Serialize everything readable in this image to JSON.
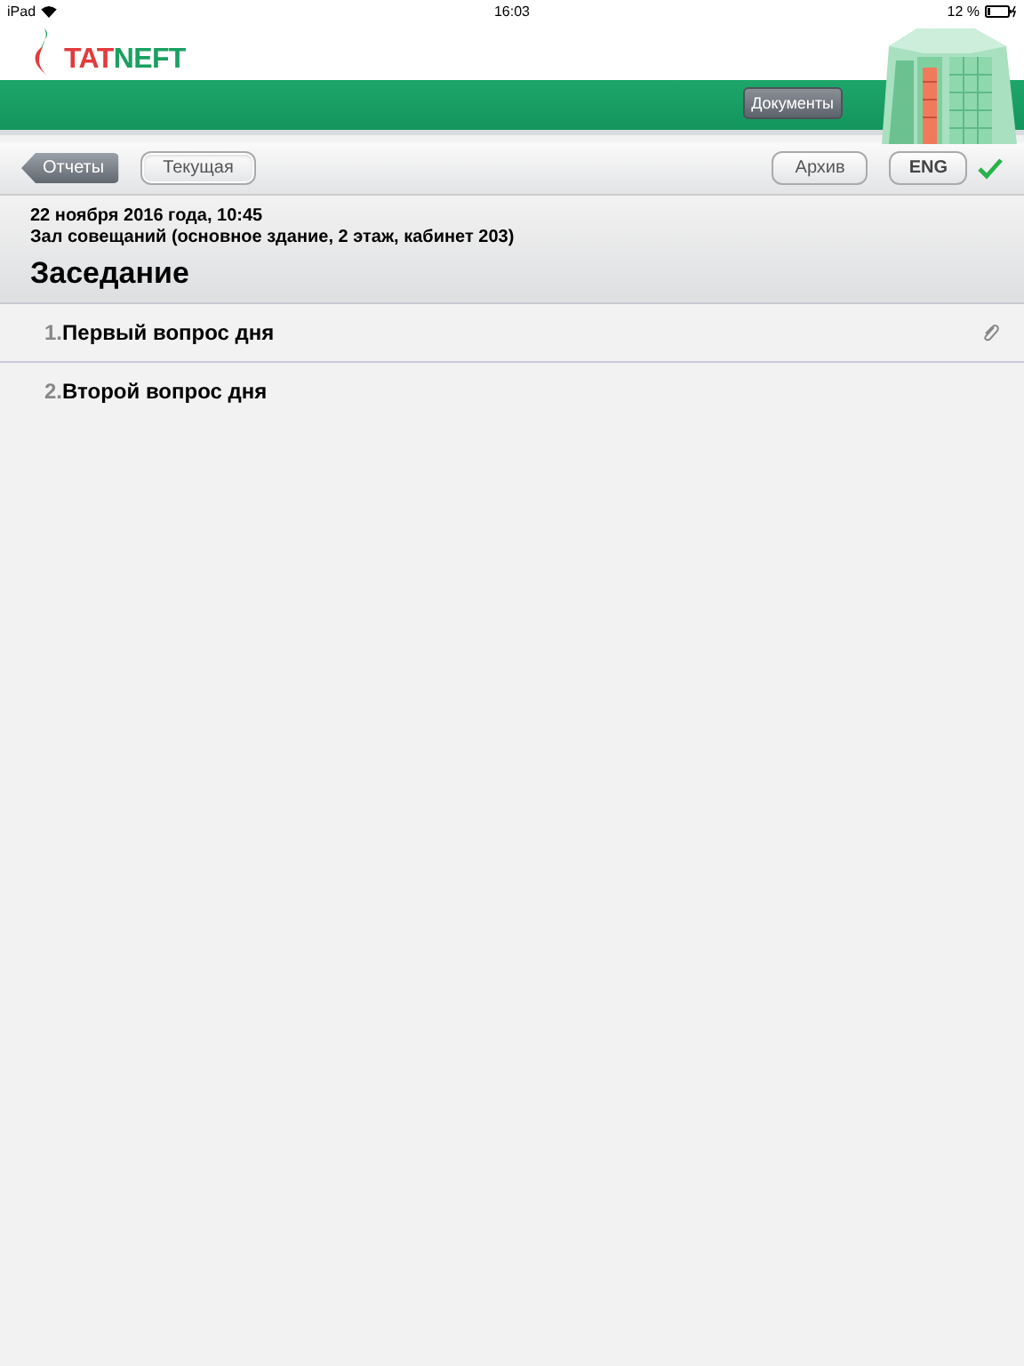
{
  "status_bar": {
    "device": "iPad",
    "time": "16:03",
    "battery": "12 %"
  },
  "header": {
    "logo": [
      "TAT",
      "NEFT"
    ],
    "documents_button": "Документы"
  },
  "toolbar": {
    "back_button": "Отчеты",
    "tabs": [
      {
        "label": "Текущая",
        "selected": true
      },
      {
        "label": "Архив",
        "selected": false
      }
    ],
    "language_button": "ENG"
  },
  "meeting": {
    "date": "22 ноября 2016 года, 10:45",
    "location": "Зал совещаний (основное здание, 2 этаж, кабинет 203)",
    "title": "Заседание"
  },
  "agenda": [
    {
      "number": "1.",
      "title": "Первый вопрос дня",
      "attachment": true
    },
    {
      "number": "2.",
      "title": "Второй вопрос дня",
      "attachment": false
    }
  ]
}
